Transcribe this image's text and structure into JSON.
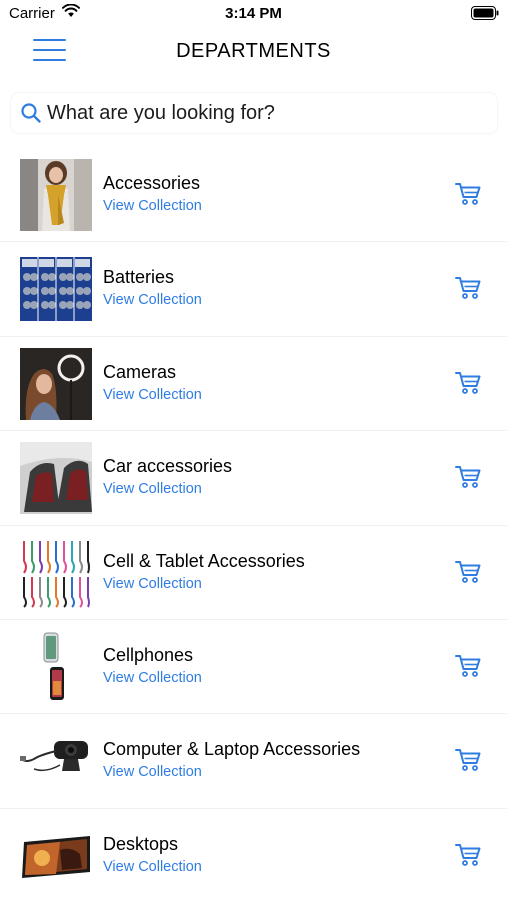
{
  "status": {
    "carrier": "Carrier",
    "time": "3:14 PM"
  },
  "header": {
    "title": "DEPARTMENTS"
  },
  "search": {
    "placeholder": "What are you looking for?"
  },
  "accent": "#2f7de1",
  "departments": [
    {
      "name": "Accessories",
      "link": "View Collection"
    },
    {
      "name": "Batteries",
      "link": "View Collection"
    },
    {
      "name": "Cameras",
      "link": "View Collection"
    },
    {
      "name": "Car accessories",
      "link": "View Collection"
    },
    {
      "name": "Cell & Tablet Accessories",
      "link": "View Collection"
    },
    {
      "name": "Cellphones",
      "link": "View Collection"
    },
    {
      "name": "Computer & Laptop Accessories",
      "link": "View Collection"
    },
    {
      "name": "Desktops",
      "link": "View Collection"
    }
  ]
}
